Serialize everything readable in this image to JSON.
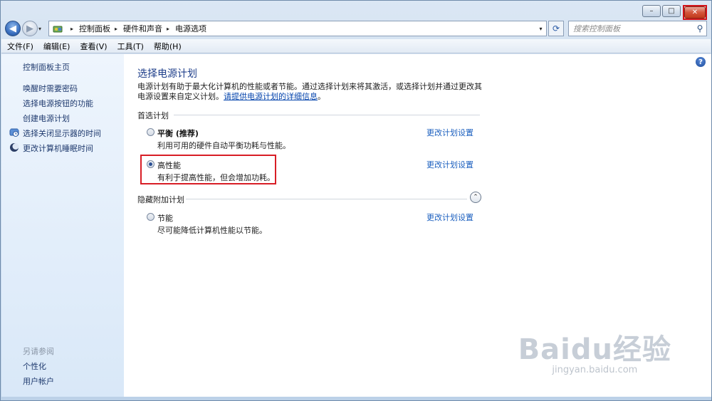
{
  "window": {
    "minimize_glyph": "–",
    "maximize_glyph": "□",
    "close_glyph": "✕"
  },
  "nav": {
    "back_glyph": "◀",
    "forward_glyph": "▶",
    "dropdown_glyph": "▾",
    "address": {
      "icon": "control-panel-icon",
      "crumbs": [
        "控制面板",
        "硬件和声音",
        "电源选项"
      ],
      "separator": "▸"
    },
    "refresh_glyph": "⟳",
    "search_placeholder": "搜索控制面板",
    "search_glyph": "⚲"
  },
  "menubar": {
    "items": [
      "文件(F)",
      "编辑(E)",
      "查看(V)",
      "工具(T)",
      "帮助(H)"
    ]
  },
  "sidebar": {
    "home": "控制面板主页",
    "links": [
      "唤醒时需要密码",
      "选择电源按钮的功能",
      "创建电源计划",
      "选择关闭显示器的时间",
      "更改计算机睡眠时间"
    ],
    "see_also_label": "另请参阅",
    "see_also": [
      "个性化",
      "用户帐户"
    ]
  },
  "main": {
    "help_glyph": "?",
    "title": "选择电源计划",
    "description": "电源计划有助于最大化计算机的性能或者节能。通过选择计划来将其激活，或选择计划并通过更改其电源设置来自定义计划。",
    "description_link": "请提供电源计划的详细信息",
    "description_end": "。",
    "preferred_label": "首选计划",
    "hidden_label": "隐藏附加计划",
    "collapse_glyph": "⌃",
    "change_link": "更改计划设置",
    "plans": [
      {
        "name": "平衡 (推荐)",
        "desc": "利用可用的硬件自动平衡功耗与性能。",
        "selected": false,
        "bold": true
      },
      {
        "name": "高性能",
        "desc": "有利于提高性能，但会增加功耗。",
        "selected": true,
        "bold": false
      },
      {
        "name": "节能",
        "desc": "尽可能降低计算机性能以节能。",
        "selected": false,
        "bold": false
      }
    ]
  },
  "watermark": {
    "main": "Baidu经验",
    "sub": "jingyan.baidu.com"
  },
  "colors": {
    "link": "#1b5fbf",
    "title": "#1e3e8a",
    "highlight": "#d81e26"
  }
}
